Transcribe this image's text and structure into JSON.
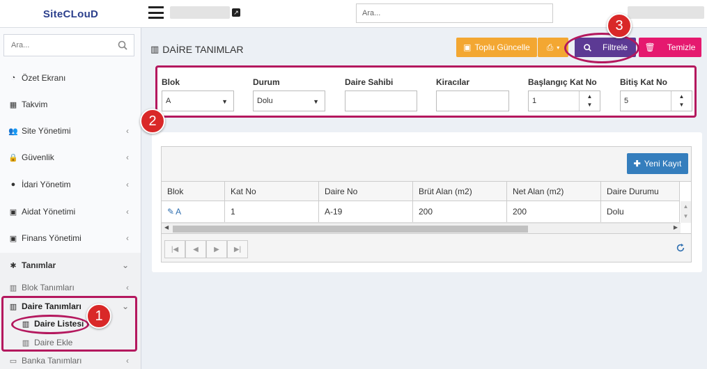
{
  "app": {
    "logo_text": "SiteCLouD",
    "top_search_placeholder": "Ara..."
  },
  "sidebar": {
    "search_placeholder": "Ara...",
    "items": [
      {
        "label": "Özet Ekranı",
        "icon": "dashboard-icon"
      },
      {
        "label": "Takvim",
        "icon": "calendar-icon"
      },
      {
        "label": "Site Yönetimi",
        "icon": "users-icon"
      },
      {
        "label": "Güvenlik",
        "icon": "lock-icon"
      },
      {
        "label": "İdari Yönetim",
        "icon": "globe-icon"
      },
      {
        "label": "Aidat Yönetimi",
        "icon": "money-icon"
      },
      {
        "label": "Finans Yönetimi",
        "icon": "money-icon"
      },
      {
        "label": "Tanımlar",
        "icon": "gear-icon"
      }
    ],
    "sub_items": [
      {
        "label": "Blok Tanımları"
      },
      {
        "label": "Daire Tanımları"
      },
      {
        "label": "Daire Listesi"
      },
      {
        "label": "Daire Ekle"
      },
      {
        "label": "Banka Tanımları"
      }
    ]
  },
  "page": {
    "title": "DAİRE TANIMLAR"
  },
  "toolbar": {
    "bulk_update_label": "Toplu Güncelle",
    "filter_label": "Filtrele",
    "clear_label": "Temizle"
  },
  "filters": {
    "blok": {
      "label": "Blok",
      "value": "A"
    },
    "durum": {
      "label": "Durum",
      "value": "Dolu"
    },
    "daire_sahibi": {
      "label": "Daire Sahibi",
      "value": ""
    },
    "kiracilar": {
      "label": "Kiracılar",
      "value": ""
    },
    "baslangic": {
      "label": "Başlangıç Kat No",
      "value": "1"
    },
    "bitis": {
      "label": "Bitiş Kat No",
      "value": "5"
    }
  },
  "grid": {
    "new_record_label": "Yeni Kayıt",
    "columns": [
      "Blok",
      "Kat No",
      "Daire No",
      "Brüt Alan (m2)",
      "Net Alan (m2)",
      "Daire Durumu"
    ],
    "rows": [
      [
        "A",
        "1",
        "A-19",
        "200",
        "200",
        "Dolu"
      ]
    ]
  },
  "annotations": {
    "badge1": "1",
    "badge2": "2",
    "badge3": "3"
  },
  "colors": {
    "accent": "#b4185e",
    "orange": "#f3a732",
    "purple": "#5c3a94",
    "pink": "#e5196f",
    "blue": "#357ebd",
    "badge": "#d92828"
  }
}
